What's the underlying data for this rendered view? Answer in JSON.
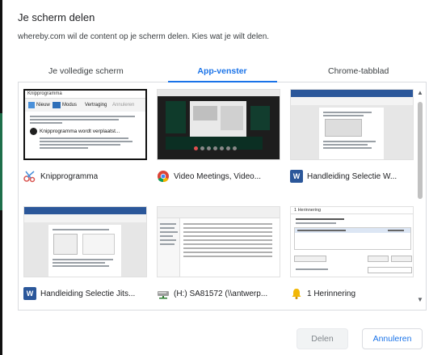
{
  "dialog": {
    "title": "Je scherm delen",
    "subtitle": "whereby.com wil de content op je scherm delen. Kies wat je wilt delen."
  },
  "tabs": [
    {
      "label": "Je volledige scherm",
      "active": false
    },
    {
      "label": "App-venster",
      "active": true
    },
    {
      "label": "Chrome-tabblad",
      "active": false
    }
  ],
  "windows": [
    {
      "label": "Knipprogramma",
      "icon": "scissors-icon"
    },
    {
      "label": "Video Meetings, Video...",
      "icon": "chrome-icon"
    },
    {
      "label": "Handleiding Selectie W...",
      "icon": "word-icon"
    },
    {
      "label": "Handleiding Selectie Jits...",
      "icon": "word-icon"
    },
    {
      "label": "(H:) SA81572 (\\\\antwerp...",
      "icon": "network-drive-icon"
    },
    {
      "label": "1 Herinnering",
      "icon": "bell-icon"
    }
  ],
  "thumbnail_text": {
    "snip_title": "Knipprogramma",
    "snip_menu": "Nieuw",
    "snip_mode": "Modus",
    "snip_delay": "Vertraging",
    "snip_cancel": "Annuleren",
    "snip_opties": "Opties",
    "snip_notice": "Knipprogramma wordt verplaatst...",
    "reminder_title": "1 Herinnering"
  },
  "buttons": {
    "share_label": "Delen",
    "cancel_label": "Annuleren"
  },
  "colors": {
    "accent": "#1a73e8",
    "word_blue": "#2b579a",
    "chrome_red": "#db4437",
    "disabled": "#80868b"
  }
}
